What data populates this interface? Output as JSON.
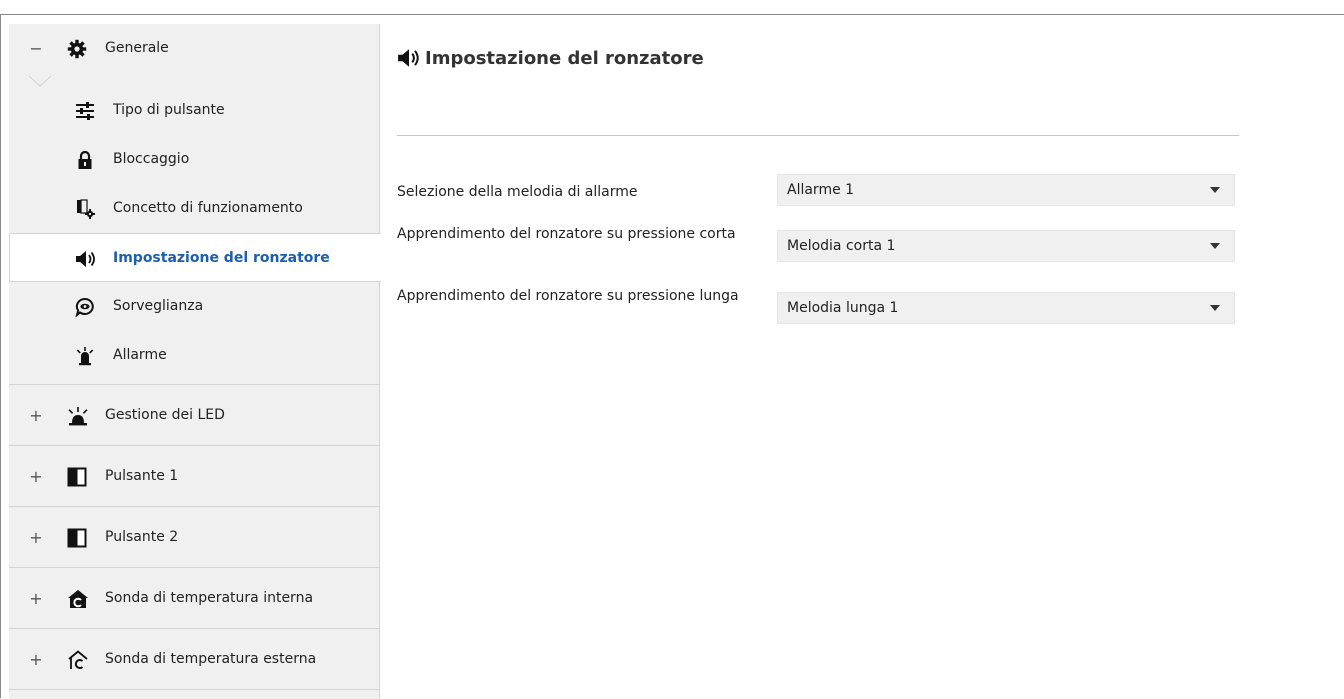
{
  "sidebar": {
    "general": {
      "toggle": "−",
      "label": "Generale",
      "icon": "gear-icon"
    },
    "sub_items": [
      {
        "label": "Tipo di pulsante",
        "icon": "sliders-icon"
      },
      {
        "label": "Bloccaggio",
        "icon": "lock-icon"
      },
      {
        "label": "Concetto di funzionamento",
        "icon": "button-config-icon"
      },
      {
        "label": "Impostazione del ronzatore",
        "icon": "speaker-icon",
        "active": true
      },
      {
        "label": "Sorveglianza",
        "icon": "eye-chat-icon"
      },
      {
        "label": "Allarme",
        "icon": "alarm-bell-icon"
      }
    ],
    "groups": [
      {
        "toggle": "+",
        "label": "Gestione dei LED",
        "icon": "led-icon"
      },
      {
        "toggle": "+",
        "label": "Pulsante 1",
        "icon": "push-button-icon"
      },
      {
        "toggle": "+",
        "label": "Pulsante 2",
        "icon": "push-button-icon"
      },
      {
        "toggle": "+",
        "label": "Sonda di temperatura interna",
        "icon": "temp-internal-icon"
      },
      {
        "toggle": "+",
        "label": "Sonda di temperatura esterna",
        "icon": "temp-external-icon"
      }
    ]
  },
  "main": {
    "title": "Impostazione del ronzatore",
    "fields": [
      {
        "label": "Selezione della melodia di allarme",
        "value": "Allarme 1"
      },
      {
        "label": "Apprendimento del ronzatore su pressione corta",
        "value": "Melodia corta 1"
      },
      {
        "label": "Apprendimento del ronzatore su pressione lunga",
        "value": "Melodia lunga 1"
      }
    ]
  },
  "colors": {
    "accent": "#1c5fae",
    "sidebar_bg": "#f0f0f0",
    "select_bg": "#f0f0f0"
  }
}
